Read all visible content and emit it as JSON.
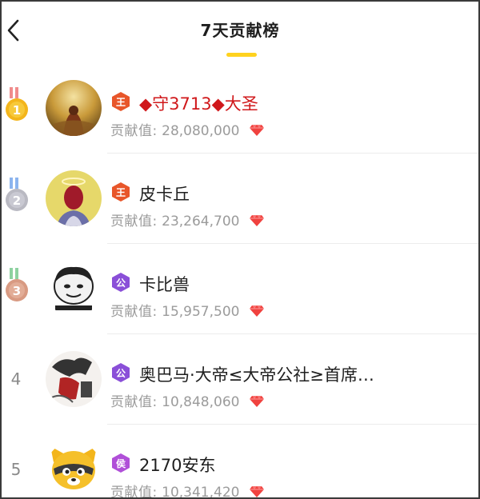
{
  "header": {
    "title": "7天贡献榜"
  },
  "list": {
    "contribution_label": "贡献值:",
    "items": [
      {
        "rank": "1",
        "name": "◆守3713◆大圣",
        "value": "28,080,000",
        "badge_text": "王",
        "badge_color": "#e8562a"
      },
      {
        "rank": "2",
        "name": "皮卡丘",
        "value": "23,264,700",
        "badge_text": "王",
        "badge_color": "#e8562a"
      },
      {
        "rank": "3",
        "name": "卡比兽",
        "value": "15,957,500",
        "badge_text": "公",
        "badge_color": "#8a4fd8"
      },
      {
        "rank": "4",
        "name": "奥巴马·大帝≤大帝公社≥首席…",
        "value": "10,848,060",
        "badge_text": "公",
        "badge_color": "#8a4fd8"
      },
      {
        "rank": "5",
        "name": "2170安东",
        "value": "10,341,420",
        "badge_text": "侯",
        "badge_color": "#b04fd8"
      }
    ]
  },
  "colors": {
    "accent_yellow": "#ffd21e",
    "gem_red": "#f0423f",
    "name_highlight_red": "#d0181b",
    "gold_medal": "#f3b51b",
    "silver_medal": "#b9b9c2",
    "bronze_medal": "#d89a82"
  }
}
